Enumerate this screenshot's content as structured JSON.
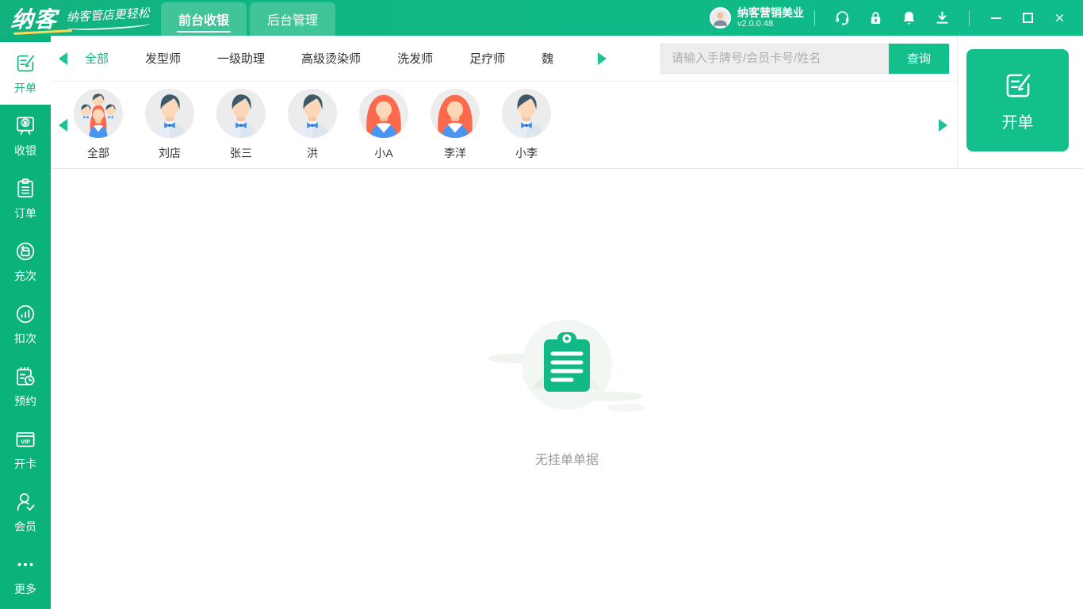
{
  "app": {
    "logo": "纳客",
    "slogan": "纳客管店更轻松",
    "tabs": [
      {
        "label": "前台收银",
        "active": true
      },
      {
        "label": "后台管理",
        "active": false
      }
    ],
    "user": {
      "name": "纳客营销美业",
      "version": "v2.0.0.48"
    },
    "topbar_icons": [
      "customer-service-icon",
      "lock-icon",
      "bell-icon",
      "download-icon"
    ],
    "window_controls": [
      "minimize",
      "maximize",
      "close"
    ]
  },
  "sidebar": {
    "items": [
      {
        "label": "开单",
        "icon": "bill-icon",
        "active": true
      },
      {
        "label": "收银",
        "icon": "cashier-icon",
        "active": false
      },
      {
        "label": "订单",
        "icon": "orders-icon",
        "active": false
      },
      {
        "label": "充次",
        "icon": "recharge-icon",
        "active": false
      },
      {
        "label": "扣次",
        "icon": "deduct-icon",
        "active": false
      },
      {
        "label": "预约",
        "icon": "appointment-icon",
        "active": false
      },
      {
        "label": "开卡",
        "icon": "vip-card-icon",
        "active": false
      },
      {
        "label": "会员",
        "icon": "member-icon",
        "active": false
      },
      {
        "label": "更多",
        "icon": "more-icon",
        "active": false
      }
    ]
  },
  "categories": {
    "items": [
      {
        "label": "全部",
        "active": true
      },
      {
        "label": "发型师",
        "active": false
      },
      {
        "label": "一级助理",
        "active": false
      },
      {
        "label": "高级烫染师",
        "active": false
      },
      {
        "label": "洗发师",
        "active": false
      },
      {
        "label": "足疗师",
        "active": false
      },
      {
        "label": "魏",
        "active": false
      }
    ]
  },
  "search": {
    "placeholder": "请输入手牌号/会员卡号/姓名",
    "value": "",
    "button_label": "查询"
  },
  "staff": {
    "items": [
      {
        "name": "全部",
        "avatar": "group"
      },
      {
        "name": "刘店",
        "avatar": "male"
      },
      {
        "name": "张三",
        "avatar": "male"
      },
      {
        "name": "洪",
        "avatar": "male"
      },
      {
        "name": "小A",
        "avatar": "female"
      },
      {
        "name": "李洋",
        "avatar": "female"
      },
      {
        "name": "小李",
        "avatar": "male"
      }
    ]
  },
  "action_panel": {
    "bill_button_label": "开单"
  },
  "workspace": {
    "empty_text": "无挂单单据"
  },
  "colors": {
    "topbar_green": "#11b27e",
    "sidebar_green": "#0bb279",
    "tab_green": "#41c598",
    "accent_green": "#13c08c",
    "active_text_green": "#14b87f",
    "logo_underline_yellow": "#ffd95a",
    "female_hair": "#fc6a4d",
    "male_hair": "#3c5a68",
    "bowtie_blue": "#3e8ee8"
  }
}
